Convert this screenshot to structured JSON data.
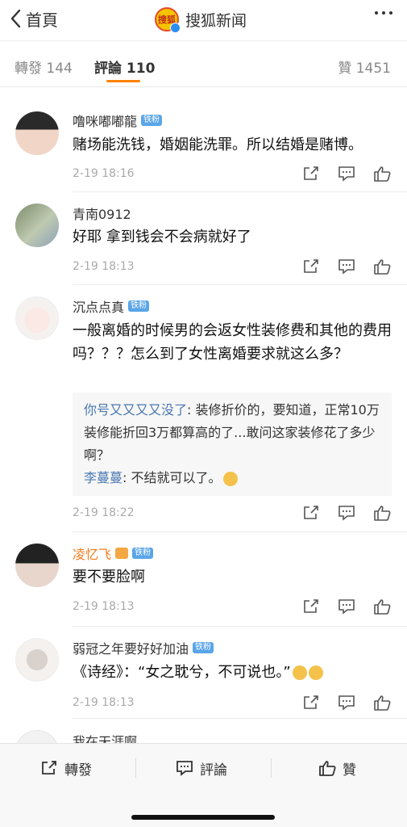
{
  "header": {
    "back_label": "首頁",
    "title": "搜狐新闻",
    "logo_text": "搜狐"
  },
  "tabs": [
    {
      "label": "轉發 144"
    },
    {
      "label": "評論 110"
    },
    {
      "label": "贊 1451"
    }
  ],
  "comments": [
    {
      "name": "噜咪嘟嘟龍",
      "badge": "铁粉",
      "text": "赌场能洗钱，婚姻能洗罪。所以结婚是赌博。",
      "time": "2-19 18:16"
    },
    {
      "name": "青南0912",
      "badge": "",
      "text": "好耶 拿到钱会不会病就好了",
      "time": "2-19 18:13"
    },
    {
      "name": "沉点点真",
      "badge": "铁粉",
      "text": "一般离婚的时候男的会返女性装修费和其他的费用吗？？？怎么到了女性离婚要求就这么多？",
      "time": "2-19 18:22",
      "replies": [
        {
          "author": "你号又又又又没了",
          "text": ": 装修折价的，要知道，正常10万装修能折回3万都算高的了...敢问这家装修花了多少啊？"
        },
        {
          "author": "李蔓蔓",
          "text": ": 不结就可以了。"
        }
      ]
    },
    {
      "name": "凌忆飞",
      "badge": "铁粉",
      "text": "要不要脸啊",
      "time": "2-19 18:13"
    },
    {
      "name": "弱冠之年要好好加油",
      "badge": "铁粉",
      "text": "《诗经》：“女之耽兮，不可说也。”",
      "time": "2-19 18:13"
    },
    {
      "name": "我在天涯啊",
      "badge": "",
      "text": "",
      "time": ""
    }
  ],
  "bottom_bar": {
    "repost_label": "轉發",
    "comment_label": "評論",
    "like_label": "贊"
  },
  "colors": {
    "accent": "#ff8200",
    "fan_badge": "#5aa5e8",
    "reply_author": "#4a78b0",
    "time": "#aaaaaa"
  }
}
